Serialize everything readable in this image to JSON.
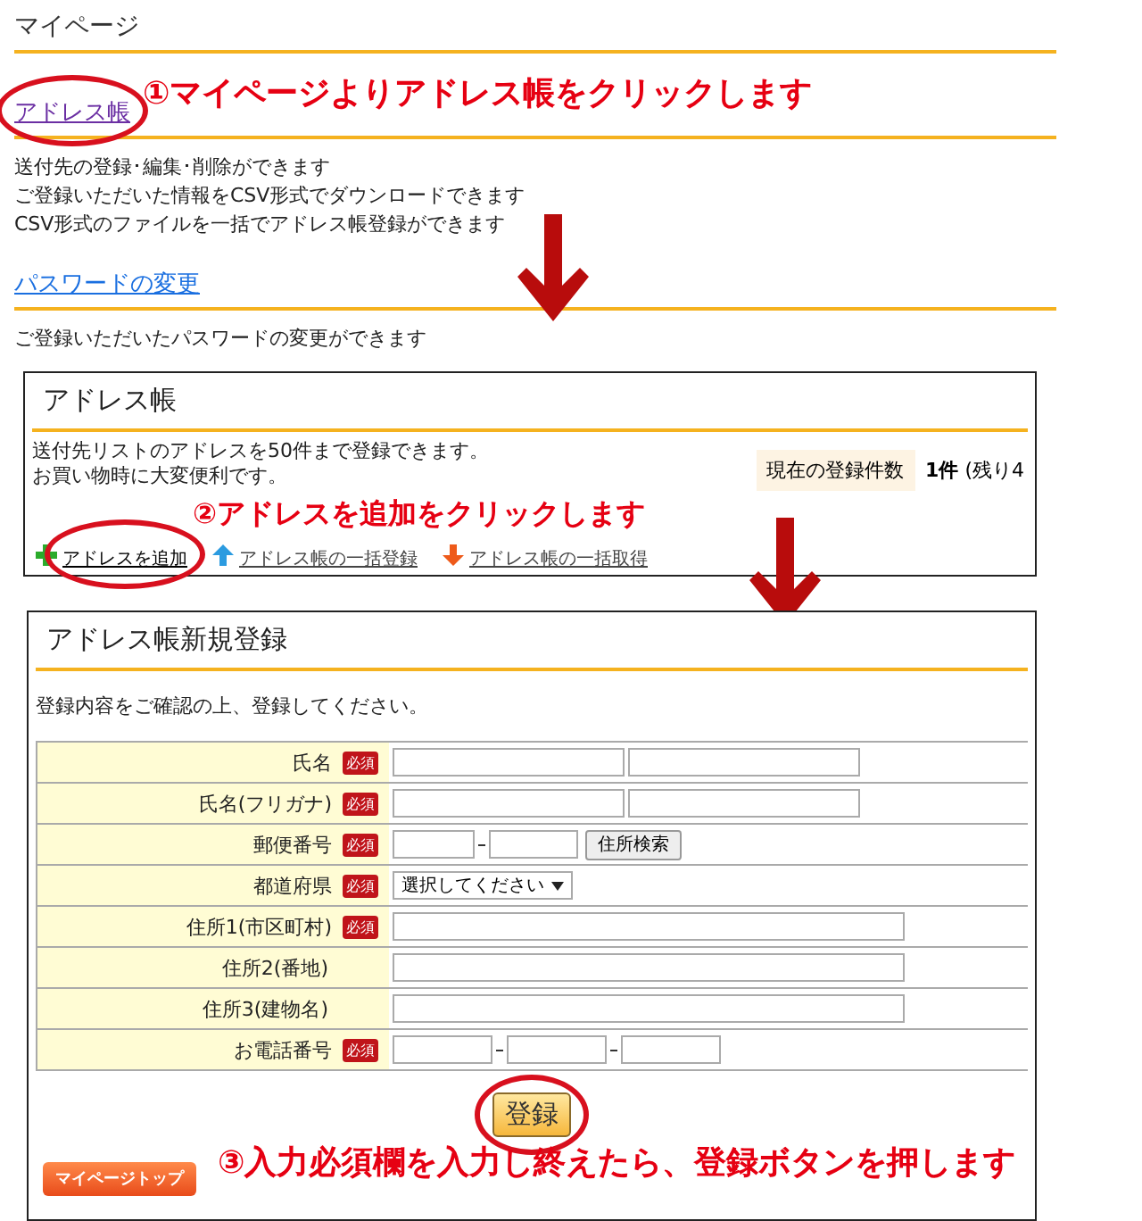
{
  "page": {
    "title": "マイページ",
    "sections": [
      {
        "link": "アドレス帳",
        "highlighted": true,
        "lines": [
          "送付先の登録･編集･削除ができます",
          "ご登録いただいた情報をCSV形式でダウンロードできます",
          "CSV形式のファイルを一括でアドレス帳登録ができます"
        ]
      },
      {
        "link": "パスワードの変更",
        "highlighted": false,
        "lines": [
          "ご登録いただいたパスワードの変更ができます"
        ]
      }
    ]
  },
  "address_book": {
    "title": "アドレス帳",
    "lines": [
      "送付先リストのアドレスを50件まで登録できます。",
      "お買い物時に大変便利です。"
    ],
    "count": {
      "label": "現在の登録件数",
      "value": "1件",
      "note": "(残り4"
    },
    "actions": [
      {
        "label": "アドレスを追加",
        "highlighted": true
      },
      {
        "label": "アドレス帳の一括登録",
        "highlighted": false
      },
      {
        "label": "アドレス帳の一括取得",
        "highlighted": false
      }
    ]
  },
  "new_entry": {
    "title": "アドレス帳新規登録",
    "description": "登録内容をご確認の上、登録してください。",
    "fields": [
      {
        "label": "氏名",
        "badge": "必須",
        "kind": "pair"
      },
      {
        "label": "氏名(フリガナ)",
        "badge": "必須",
        "kind": "pair"
      },
      {
        "label": "郵便番号",
        "badge": "必須",
        "kind": "zip",
        "button": "住所検索"
      },
      {
        "label": "都道府県",
        "badge": "必須",
        "kind": "select",
        "value": "選択してください"
      },
      {
        "label": "住所1(市区町村)",
        "badge": "必須",
        "kind": "wide"
      },
      {
        "label": "住所2(番地)",
        "kind": "wide"
      },
      {
        "label": "住所3(建物名)",
        "kind": "wide"
      },
      {
        "label": "お電話番号",
        "badge": "必須",
        "kind": "phone"
      }
    ],
    "submit": {
      "label": "登録",
      "highlighted": true
    },
    "top_button": "マイページトップ"
  },
  "steps": [
    "①マイページよりアドレス帳をクリックします",
    "②アドレスを追加をクリックします",
    "③入力必須欄を入力し終えたら、登録ボタンを押します"
  ]
}
